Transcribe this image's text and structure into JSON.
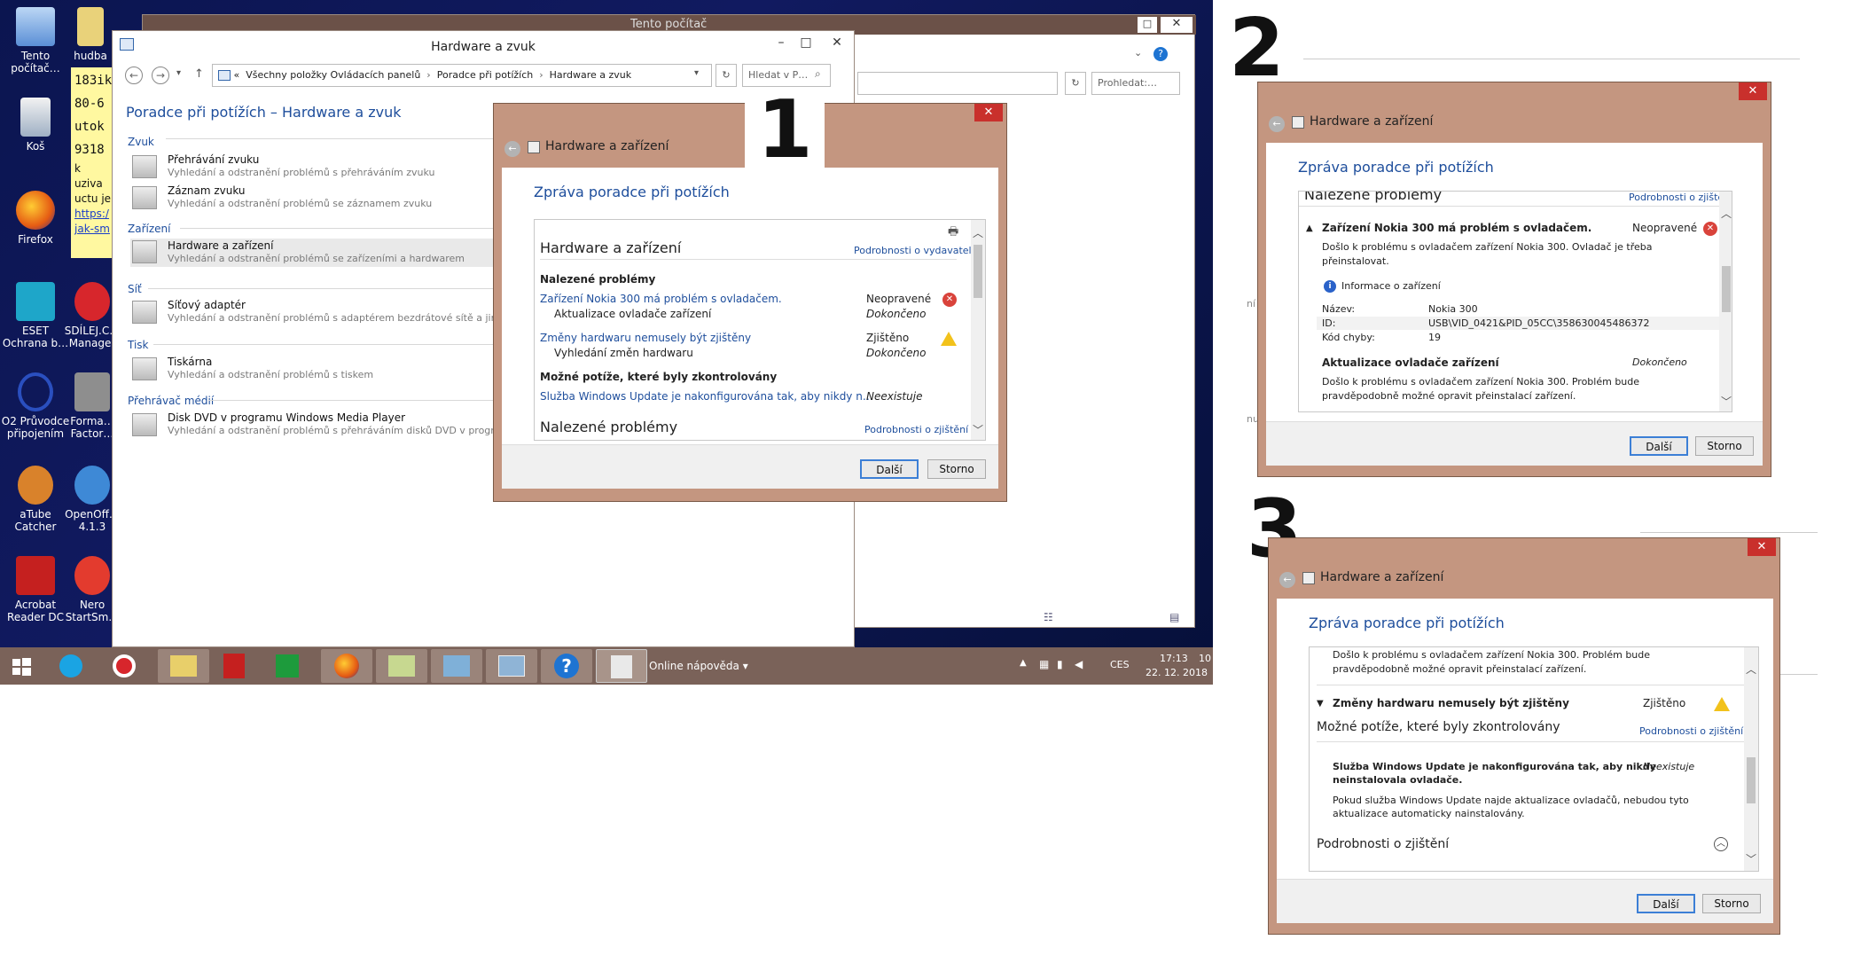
{
  "desktop": {
    "icons": [
      {
        "label": "Tento\npočítač…"
      },
      {
        "label": "hudba"
      },
      {
        "label": "Koš"
      },
      {
        "label": "Firefox"
      },
      {
        "label": "ESET\nOchrana b…"
      },
      {
        "label": "SDÍLEJ.C…\nManager"
      },
      {
        "label": "O2 Průvodce\npřipojením"
      },
      {
        "label": "Forma…\nFactor…"
      },
      {
        "label": "aTube\nCatcher"
      },
      {
        "label": "OpenOff…\n4.1.3"
      },
      {
        "label": "Acrobat\nReader DC"
      },
      {
        "label": "Nero\nStartSm…"
      }
    ],
    "note": {
      "lines": [
        "183ik",
        "80-6",
        "utok",
        "9318",
        "k uziva",
        "uctu je"
      ],
      "links": [
        "https:/",
        "jak-sm"
      ]
    }
  },
  "bg_window": {
    "title": "Tento počítač",
    "search_placeholder": "Prohledat:…",
    "side_text_1": "ní",
    "side_text_2": "nu"
  },
  "cp_window": {
    "title": "Hardware a zvuk",
    "breadcrumb": [
      "«",
      "Všechny položky Ovládacích panelů",
      "Poradce při potížích",
      "Hardware a zvuk"
    ],
    "search_placeholder": "Hledat v P…",
    "heading": "Poradce při potížích – Hardware a zvuk",
    "categories": [
      {
        "name": "Zvuk",
        "items": [
          {
            "title": "Přehrávání zvuku",
            "desc": "Vyhledání a odstranění problémů s přehráváním zvuku"
          },
          {
            "title": "Záznam zvuku",
            "desc": "Vyhledání a odstranění problémů se záznamem zvuku"
          }
        ]
      },
      {
        "name": "Zařízení",
        "items": [
          {
            "title": "Hardware a zařízení",
            "desc": "Vyhledání a odstranění problémů se zařízeními a hardwarem"
          }
        ]
      },
      {
        "name": "Síť",
        "items": [
          {
            "title": "Síťový adaptér",
            "desc": "Vyhledání a odstranění problémů s adaptérem bezdrátové sítě a jinými"
          }
        ]
      },
      {
        "name": "Tisk",
        "items": [
          {
            "title": "Tiskárna",
            "desc": "Vyhledání a odstranění problémů s tiskem"
          }
        ]
      },
      {
        "name": "Přehrávač médií",
        "items": [
          {
            "title": "Disk DVD v programu Windows Media Player",
            "desc": "Vyhledání a odstranění problémů s přehráváním disků DVD v programu"
          }
        ]
      }
    ]
  },
  "taskbar": {
    "online_help": "Online nápověda",
    "lang": "CES",
    "time": "17:13",
    "date": "22. 12. 2018",
    "extra": "10"
  },
  "labels": {
    "n1": "1",
    "n2": "2",
    "n3": "3"
  },
  "dialog_common": {
    "title": "Hardware a zařízení",
    "header": "Zpráva poradce při potížích",
    "next": "Další",
    "cancel": "Storno"
  },
  "dialog1": {
    "section_title": "Hardware a zařízení",
    "publisher_link": "Podrobnosti o vydavateli",
    "found_problems": "Nalezené problémy",
    "rows": [
      {
        "text": "Zařízení Nokia 300 má problém s ovladačem.",
        "status": "Neopravené"
      },
      {
        "text": "Aktualizace ovladače zařízení",
        "status": "Dokončeno"
      },
      {
        "text": "Změny hardwaru nemusely být zjištěny",
        "status": "Zjištěno"
      },
      {
        "text": "Vyhledání změn hardwaru",
        "status": "Dokončeno"
      }
    ],
    "checked_title": "Možné potíže, které byly zkontrolovány",
    "checked_row": {
      "text": "Služba Windows Update je nakonfigurována tak, aby nikdy n…",
      "status": "Neexistuje"
    },
    "bottom_title": "Nalezené problémy",
    "bottom_link": "Podrobnosti o zjištění"
  },
  "dialog2": {
    "top_title": "Nalezené problémy",
    "top_link": "Podrobnosti o zjištění",
    "problem": "Zařízení Nokia 300 má problém s ovladačem.",
    "problem_status": "Neopravené",
    "problem_desc_1": "Došlo k problému s ovladačem zařízení Nokia 300. Ovladač je třeba",
    "problem_desc_2": "přeinstalovat.",
    "info_title": "Informace o zařízení",
    "info": [
      {
        "key": "Název:",
        "val": "Nokia 300"
      },
      {
        "key": "ID:",
        "val": "USB\\VID_0421&PID_05CC\\358630045486372"
      },
      {
        "key": "Kód chyby:",
        "val": "19"
      }
    ],
    "update_title": "Aktualizace ovladače zařízení",
    "update_status": "Dokončeno",
    "update_desc_1": "Došlo k problému s ovladačem zařízení Nokia 300. Problém bude",
    "update_desc_2": "pravděpodobně možné opravit přeinstalací zařízení."
  },
  "dialog3": {
    "top_desc_1": "Došlo k problému s ovladačem zařízení Nokia 300. Problém bude",
    "top_desc_2": "pravděpodobně možné opravit přeinstalací zařízení.",
    "hw_title": "Změny hardwaru nemusely být zjištěny",
    "hw_status": "Zjištěno",
    "checked_title": "Možné potíže, které byly zkontrolovány",
    "checked_link": "Podrobnosti o zjištění",
    "wu_title_1": "Služba Windows Update je nakonfigurována tak, aby nikdy",
    "wu_title_2": "neinstalovala ovladače.",
    "wu_status": "Neexistuje",
    "wu_desc_1": "Pokud služba Windows Update najde aktualizace ovladačů, nebudou tyto",
    "wu_desc_2": "aktualizace automaticky nainstalovány.",
    "details_title": "Podrobnosti o zjištění"
  }
}
